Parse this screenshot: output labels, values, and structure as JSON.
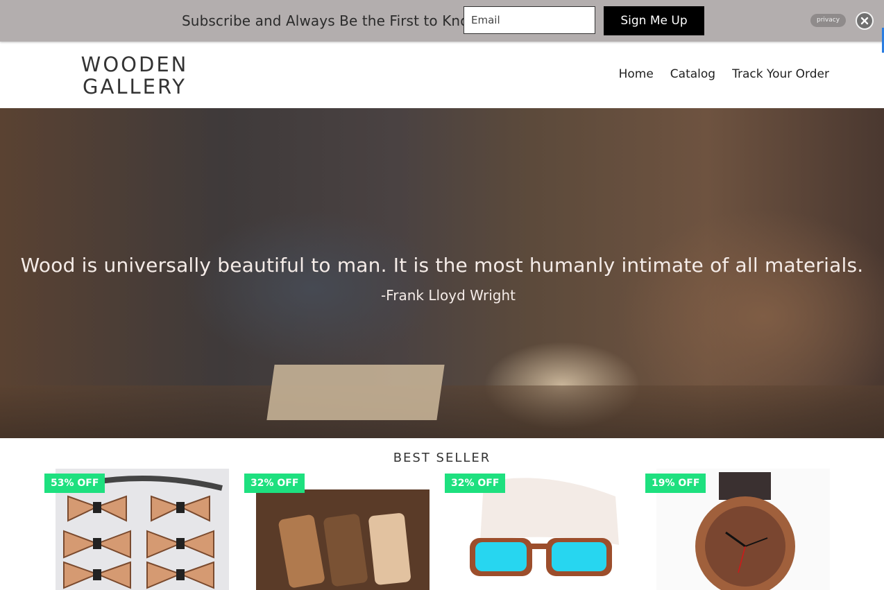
{
  "subscribe": {
    "text": "Subscribe and Always Be the First to Know",
    "email_placeholder": "Email",
    "button_label": "Sign Me Up",
    "privacy_label": "privacy"
  },
  "header": {
    "logo_line1": "WOODEN",
    "logo_line2": "GALLERY",
    "nav": [
      {
        "label": "Home"
      },
      {
        "label": "Catalog"
      },
      {
        "label": "Track Your Order"
      }
    ]
  },
  "hero": {
    "quote": "Wood is universally beautiful to man. It is the most humanly intimate of all materials.",
    "author": "-Frank Lloyd Wright"
  },
  "best_seller": {
    "title": "BEST SELLER",
    "products": [
      {
        "badge": "53% OFF",
        "image": "wooden-bow-ties"
      },
      {
        "badge": "32% OFF",
        "image": "wooden-phone-cases"
      },
      {
        "badge": "32% OFF",
        "image": "wooden-sunglasses"
      },
      {
        "badge": "19% OFF",
        "image": "wooden-watch"
      }
    ]
  },
  "colors": {
    "subscribe_bar": "#b3aeae",
    "badge": "#1ee07f",
    "button": "#000000"
  }
}
